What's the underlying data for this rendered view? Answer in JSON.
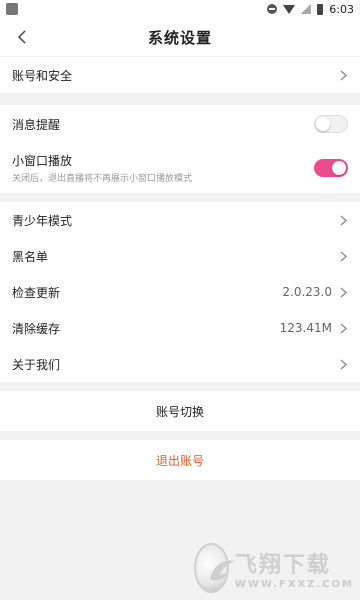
{
  "status_bar": {
    "time": "6:03"
  },
  "header": {
    "title": "系统设置"
  },
  "sections": {
    "account": {
      "label": "账号和安全"
    },
    "notifications": {
      "message_label": "消息提醒",
      "message_enabled": false,
      "pip_label": "小窗口播放",
      "pip_desc": "关闭后，退出直播将不再展示小窗口播放模式",
      "pip_enabled": true
    },
    "general": {
      "youth_mode": "青少年模式",
      "blacklist": "黑名单",
      "check_update": "检查更新",
      "version": "2.0.23.0",
      "clear_cache": "清除缓存",
      "cache_size": "123.41M",
      "about": "关于我们"
    }
  },
  "actions": {
    "switch_account": "账号切换",
    "logout": "退出账号"
  },
  "watermark": {
    "brand": "飞翔下载",
    "url": "WWW.FXXZ.COM"
  },
  "colors": {
    "accent": "#ec4c8f",
    "logout": "#e05c2a",
    "background": "#f2f2f2"
  }
}
